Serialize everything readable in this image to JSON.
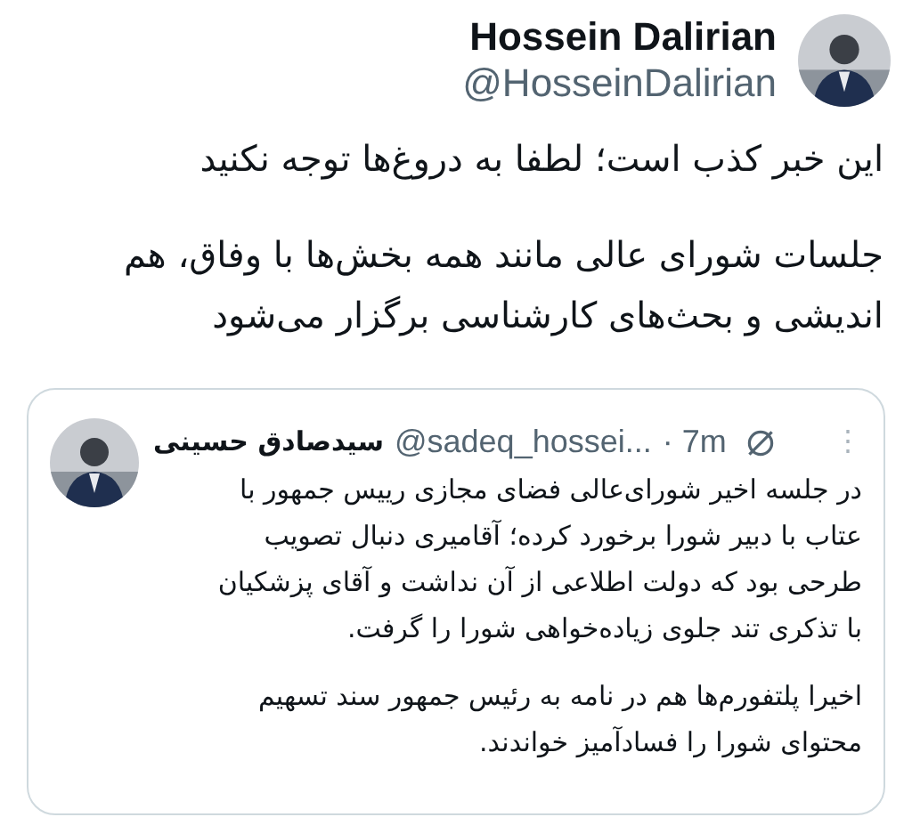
{
  "author": {
    "name": "Hossein Dalirian",
    "handle": "@HosseinDalirian"
  },
  "tweet": {
    "paragraphs": [
      "این خبر کذب است؛ لطفا به دروغ‌ها توجه نکنید",
      "جلسات شورای عالی مانند همه بخش‌ها با وفاق، هم\nاندیشی و بحث‌های کارشناسی برگزار می‌شود"
    ]
  },
  "quoted_tweet": {
    "name": "سیدصادق حسینی",
    "handle": "@sadeq_hossei...",
    "time": "· 7m",
    "more": "⋮",
    "paragraphs": [
      "در جلسه اخیر شورای‌عالی فضای مجازی رییس جمهور با\nعتاب با دبیر شورا برخورد کرده؛ آقامیری دنبال تصویب\nطرحی بود که دولت اطلاعی از آن نداشت و آقای پزشکیان\nبا تذکری تند جلوی زیاده‌خواهی شورا را گرفت.",
      "اخیرا پلتفورم‌ها هم در نامه به رئیس جمهور سند تسهیم\nمحتوای شورا را فسادآمیز خواندند."
    ]
  }
}
